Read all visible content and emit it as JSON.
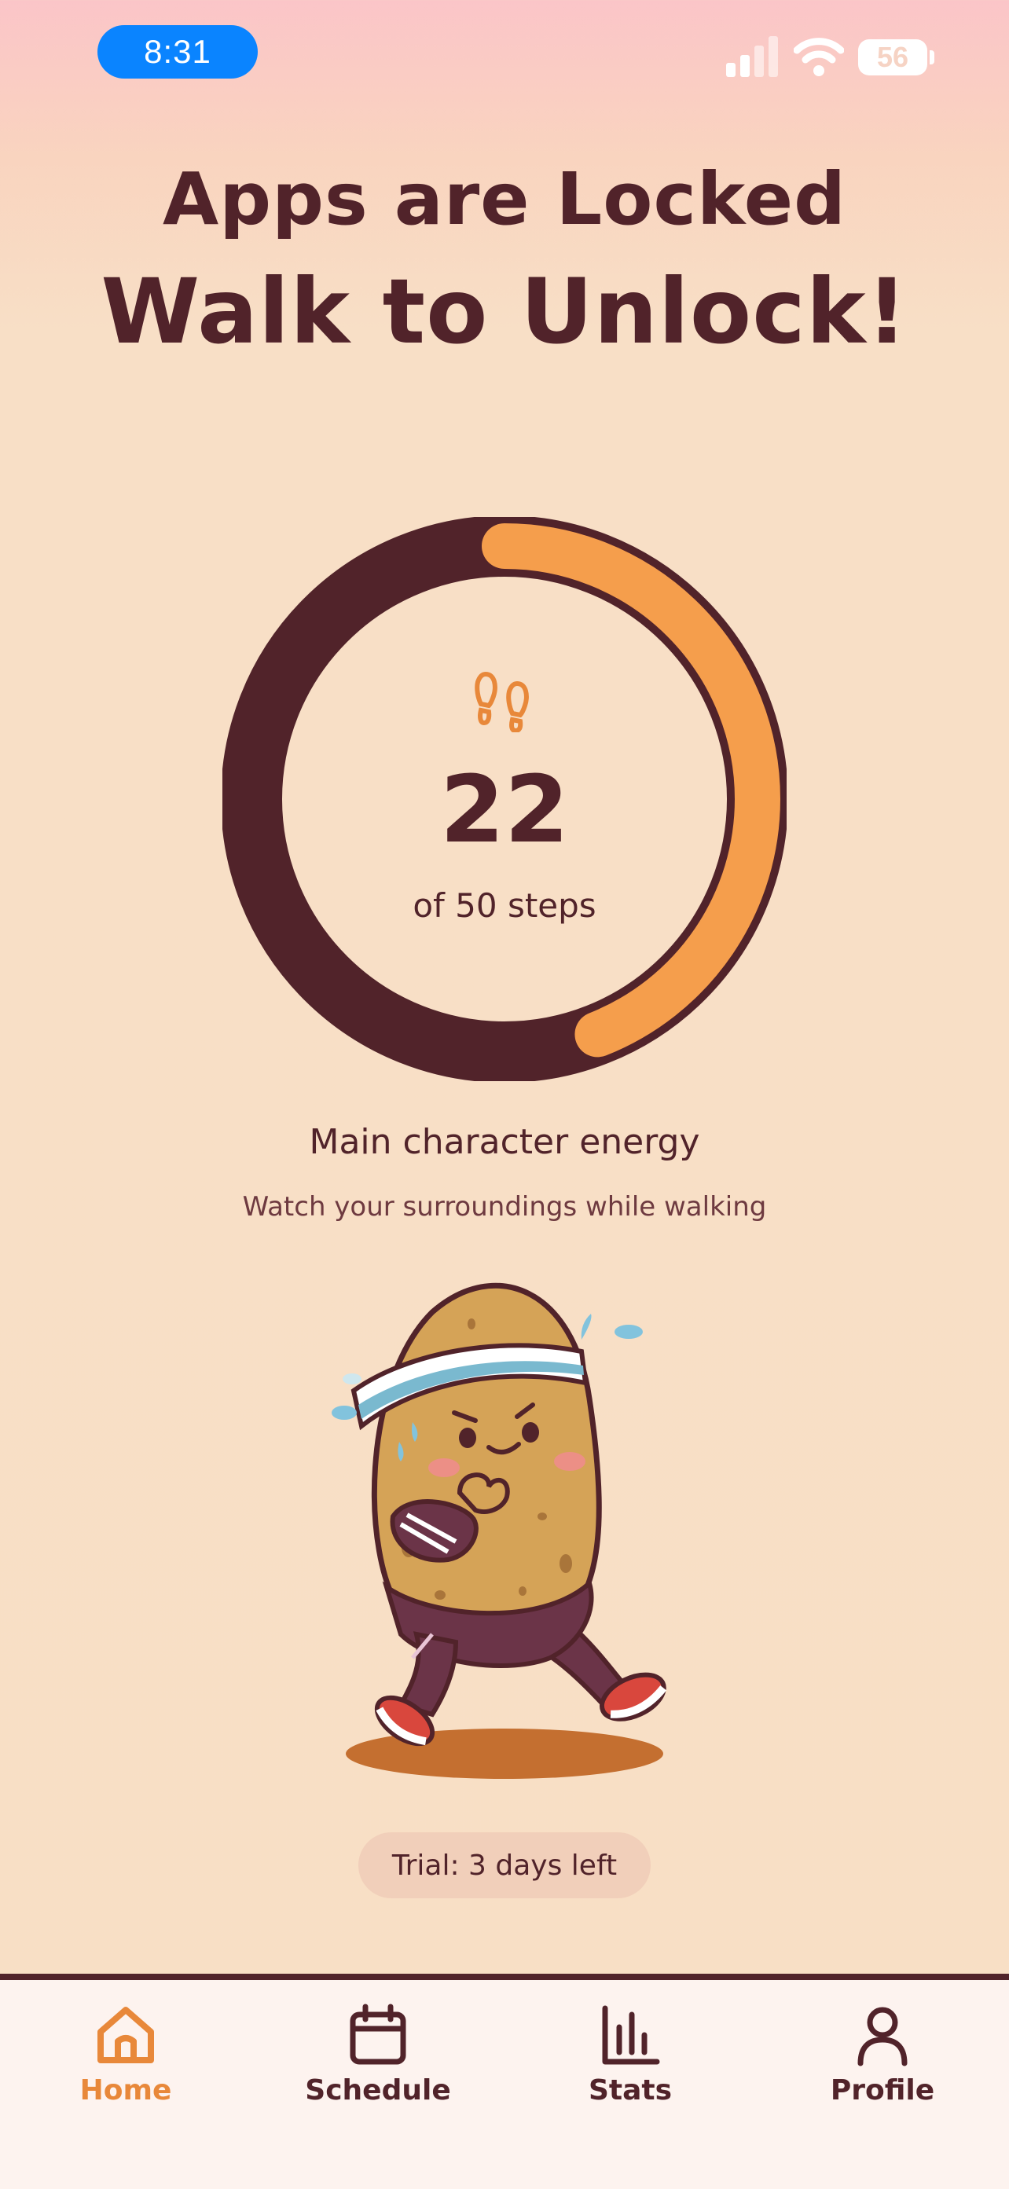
{
  "status_bar": {
    "time": "8:31",
    "battery": "56",
    "icons": [
      "signal-icon",
      "wifi-icon",
      "battery-icon"
    ]
  },
  "header": {
    "line1": "Apps are Locked",
    "line2": "Walk to Unlock!"
  },
  "progress": {
    "steps": "22",
    "goal_label": "of 50 steps",
    "fraction": 0.44,
    "colors": {
      "track": "#51232a",
      "fill": "#f59e4c",
      "icon": "#e8883a"
    }
  },
  "message": {
    "headline": "Main character energy",
    "subline": "Watch your surroundings while walking"
  },
  "trial": {
    "label": "Trial: 3 days left"
  },
  "tab_bar": {
    "tabs": [
      {
        "label": "Home",
        "icon": "home-icon",
        "active": true
      },
      {
        "label": "Schedule",
        "icon": "calendar-icon",
        "active": false
      },
      {
        "label": "Stats",
        "icon": "bar-chart-icon",
        "active": false
      },
      {
        "label": "Profile",
        "icon": "person-icon",
        "active": false
      }
    ],
    "active_color": "#e8883a",
    "inactive_color": "#51232a"
  }
}
